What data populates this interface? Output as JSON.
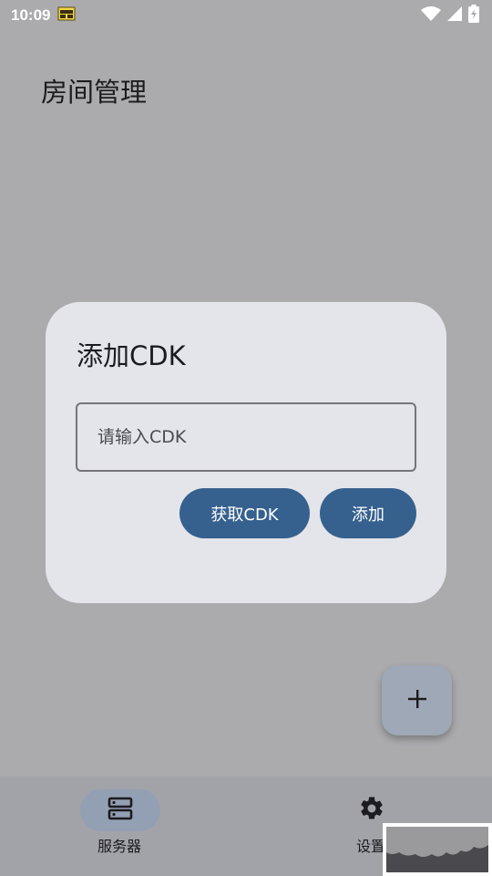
{
  "status_bar": {
    "time": "10:09",
    "notification_icon": "sim-card-icon",
    "icons": [
      "wifi-icon",
      "signal-icon",
      "battery-charging-icon"
    ]
  },
  "page": {
    "title": "房间管理"
  },
  "dialog": {
    "title": "添加CDK",
    "input": {
      "value": "",
      "placeholder": "请输入CDK"
    },
    "get_cdk_label": "获取CDK",
    "add_label": "添加"
  },
  "fab": {
    "icon": "plus-icon"
  },
  "bottom_nav": {
    "items": [
      {
        "label": "服务器",
        "icon": "server-icon",
        "selected": true
      },
      {
        "label": "设置",
        "icon": "gear-icon",
        "selected": false
      }
    ]
  },
  "colors": {
    "primary": "#36618e",
    "scrim_background": "#ababae",
    "dialog_surface": "#e4e5ea",
    "nav_indicator": "#93a0b4",
    "fab_container": "#9ea8b6"
  }
}
